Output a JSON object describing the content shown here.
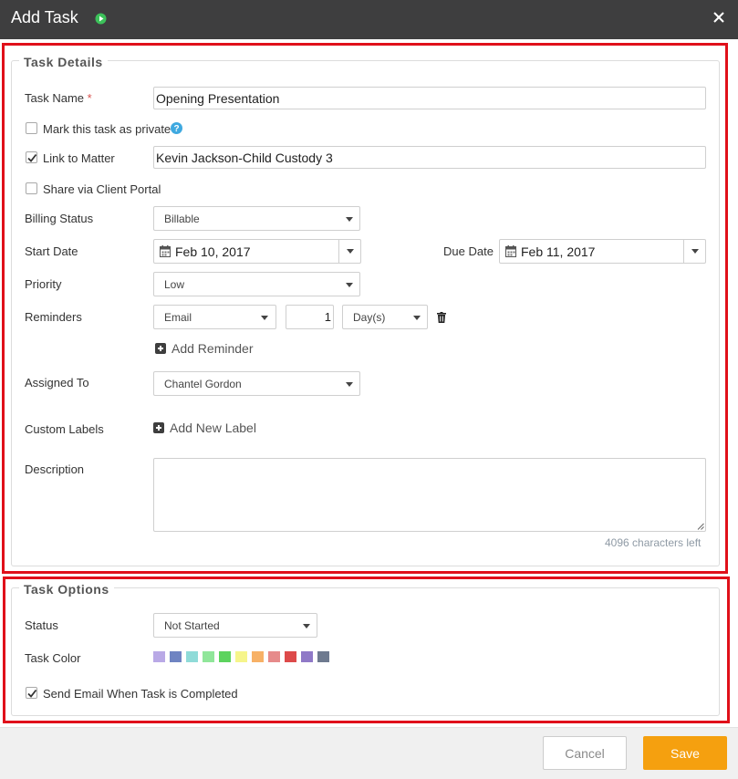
{
  "dialog": {
    "title": "Add Task",
    "close_label": "×"
  },
  "task_details": {
    "legend": "Task Details",
    "task_name": {
      "label": "Task Name",
      "required_mark": "*",
      "value": "Opening Presentation"
    },
    "private": {
      "label": "Mark this task as private",
      "checked": false
    },
    "link_to_matter": {
      "label": "Link to Matter",
      "checked": true,
      "value": "Kevin Jackson-Child Custody 3"
    },
    "client_portal": {
      "label": "Share via Client Portal",
      "checked": false
    },
    "billing_status": {
      "label": "Billing Status",
      "value": "Billable"
    },
    "start_date": {
      "label": "Start Date",
      "value": "Feb 10, 2017"
    },
    "due_date": {
      "label": "Due Date",
      "value": "Feb 11, 2017"
    },
    "priority": {
      "label": "Priority",
      "value": "Low"
    },
    "reminders": {
      "label": "Reminders",
      "method": "Email",
      "amount": "1",
      "unit": "Day(s)",
      "add_label": "Add Reminder"
    },
    "assigned_to": {
      "label": "Assigned To",
      "value": "Chantel Gordon"
    },
    "custom_labels": {
      "label": "Custom Labels",
      "add_label": "Add New Label"
    },
    "description": {
      "label": "Description",
      "value": "",
      "chars_left": "4096 characters left"
    }
  },
  "task_options": {
    "legend": "Task Options",
    "status": {
      "label": "Status",
      "value": "Not Started"
    },
    "task_color": {
      "label": "Task Color",
      "colors": [
        "#b9a9e6",
        "#6f84c2",
        "#8fdbd8",
        "#90e69a",
        "#5cd35e",
        "#f6f58b",
        "#f7b166",
        "#e68b8b",
        "#dd4a4a",
        "#8f79c7",
        "#6e7a8f"
      ]
    },
    "send_email": {
      "label": "Send Email When Task is Completed",
      "checked": true
    }
  },
  "footer": {
    "cancel_label": "Cancel",
    "save_label": "Save"
  },
  "colors": {
    "header_bg": "#3e3e3f",
    "highlight": "#e0101a",
    "save_bg": "#f5a00f",
    "help_icon": "#3fa9e0",
    "play_icon": "#3cc15a"
  },
  "icons": [
    "play-icon",
    "close-icon",
    "help-icon",
    "checkmark-icon",
    "calendar-icon",
    "chevron-down-icon",
    "trash-icon",
    "plus-icon",
    "resize-icon"
  ]
}
